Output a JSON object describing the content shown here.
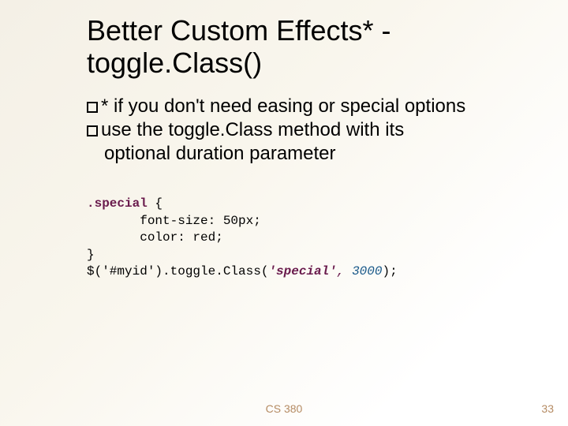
{
  "title": "Better Custom Effects* - toggle.Class()",
  "bullets": {
    "b1_prefix": "*",
    "b1_text": " if you don't need easing or special options",
    "b2_prefix": "use",
    "b2_text": " the toggle.Class method with its",
    "b3_text": "optional duration parameter"
  },
  "code": {
    "l1_a": ".special",
    "l1_b": " {",
    "l2": "       font-size: 50px;",
    "l3": "       color: red;",
    "l4": "}",
    "l5_a": "$('#myid').toggle.Class(",
    "l5_b": "'special'",
    "l5_c": ",",
    "l5_d": " ",
    "l5_e": "3000",
    "l5_f": ");"
  },
  "footer": {
    "course": "CS 380",
    "page": "33"
  }
}
